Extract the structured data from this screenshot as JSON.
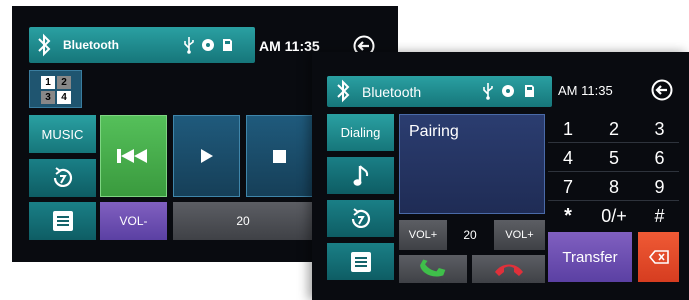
{
  "back_screen": {
    "header": {
      "title": "Bluetooth",
      "time": "AM 11:35"
    },
    "grid_numbers": [
      "1",
      "2",
      "3",
      "4"
    ],
    "music_label": "MUSIC",
    "vol_minus_label": "VOL-",
    "volume_value": "20"
  },
  "front_screen": {
    "header": {
      "title": "Bluetooth",
      "time": "AM 11:35"
    },
    "dialing_label": "Dialing",
    "status_text": "Pairing",
    "keypad": [
      "1",
      "2",
      "3",
      "4",
      "5",
      "6",
      "7",
      "8",
      "9",
      "*",
      "0/+",
      "#"
    ],
    "vol_plus_left": "VOL+",
    "volume_value": "20",
    "vol_plus_right": "VOL+",
    "transfer_label": "Transfer"
  },
  "icons": {
    "bluetooth": "bluetooth-icon",
    "usb": "usb-icon",
    "disc": "disc-icon",
    "sdcard": "sd-card-icon",
    "back": "back-arrow-icon",
    "music": "music-note-icon",
    "repeat": "repeat-icon",
    "list": "list-icon",
    "prev": "skip-previous-icon",
    "play": "play-icon",
    "stop": "stop-icon",
    "call": "call-answer-icon",
    "hangup": "call-end-icon",
    "backspace": "backspace-icon"
  },
  "colors": {
    "accent_teal": "#1e8c90",
    "active_green": "#45b049",
    "purple": "#6a4fb3",
    "delete_red": "#e04a2a",
    "call_green": "#3fbf4a",
    "hangup_red": "#e0303a"
  }
}
